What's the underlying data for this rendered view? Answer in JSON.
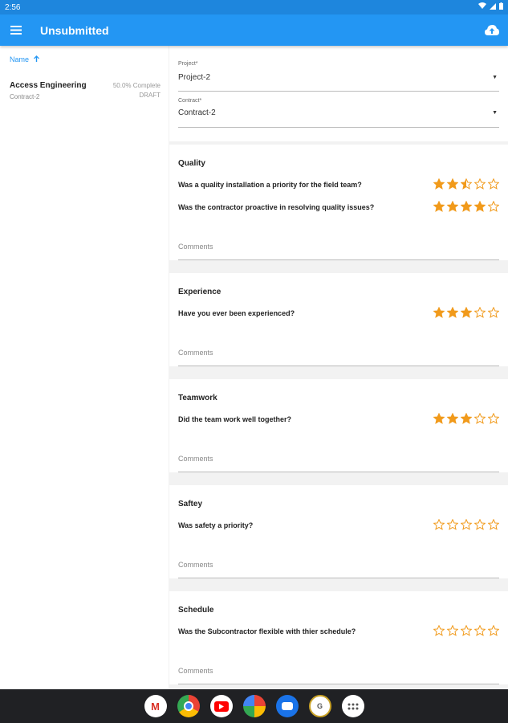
{
  "status": {
    "time": "2:56"
  },
  "appbar": {
    "title": "Unsubmitted",
    "menu_icon": "hamburger-menu-icon",
    "upload_icon": "cloud-upload-icon"
  },
  "list": {
    "sort_label": "Name",
    "items": [
      {
        "name": "Access Engineering",
        "contract": "Contract-2",
        "progress": "50.0% Complete",
        "status": "DRAFT"
      }
    ]
  },
  "form": {
    "project": {
      "label": "Project*",
      "value": "Project-2"
    },
    "contract": {
      "label": "Contract*",
      "value": "Contract-2"
    },
    "comments_placeholder": "Comments",
    "sections": [
      {
        "title": "Quality",
        "questions": [
          {
            "text": "Was a quality installation a priority for the field team?",
            "rating": 2.5
          },
          {
            "text": "Was the contractor proactive in resolving quality issues?",
            "rating": 4
          }
        ]
      },
      {
        "title": "Experience",
        "questions": [
          {
            "text": "Have you ever been experienced?",
            "rating": 3
          }
        ]
      },
      {
        "title": "Teamwork",
        "questions": [
          {
            "text": "Did the team work well together?",
            "rating": 3
          }
        ]
      },
      {
        "title": "Saftey",
        "questions": [
          {
            "text": "Was safety a priority?",
            "rating": 0
          }
        ]
      },
      {
        "title": "Schedule",
        "questions": [
          {
            "text": "Was the Subcontractor flexible with thier schedule?",
            "rating": 0
          }
        ]
      }
    ]
  },
  "colors": {
    "accent": "#2396f3",
    "star": "#f19a1b"
  },
  "dock": [
    "gmail-icon",
    "chrome-icon",
    "youtube-icon",
    "photos-icon",
    "messages-icon",
    "app-icon",
    "app-drawer-icon"
  ]
}
